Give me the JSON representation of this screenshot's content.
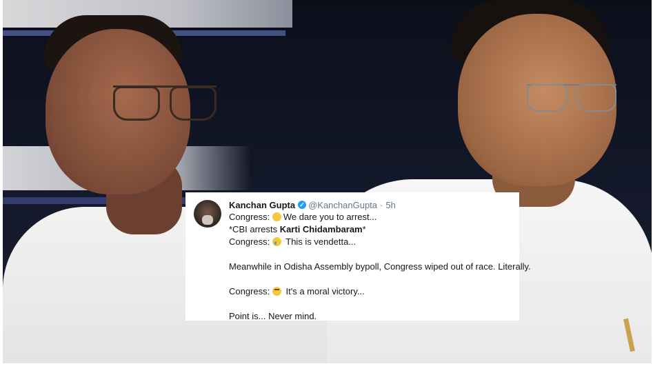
{
  "tweet": {
    "author_name": "Kanchan Gupta",
    "handle": "@KanchanGupta",
    "separator": "·",
    "time": "5h",
    "lines": {
      "l1_prefix": "Congress:",
      "l1_text": "We dare you to arrest...",
      "l2_prefix": "*CBI arrests ",
      "l2_bold": "Karti Chidambaram",
      "l2_suffix": "*",
      "l3_prefix": "Congress:",
      "l3_text": "This is vendetta...",
      "l4_text": "Meanwhile in Odisha Assembly bypoll, Congress wiped out of race. Literally.",
      "l5_prefix": "Congress:",
      "l5_text": "It's a moral victory...",
      "l6_text": "Point is... Never mind."
    },
    "icons": {
      "verified": "verified-badge-icon",
      "emoji1": "hands-over-mouth-emoji-icon",
      "emoji2": "crying-face-emoji-icon",
      "emoji3": "eye-roll-emoji-icon"
    },
    "colors": {
      "text": "#14171a",
      "muted": "#657786",
      "verified": "#1da1f2"
    }
  }
}
